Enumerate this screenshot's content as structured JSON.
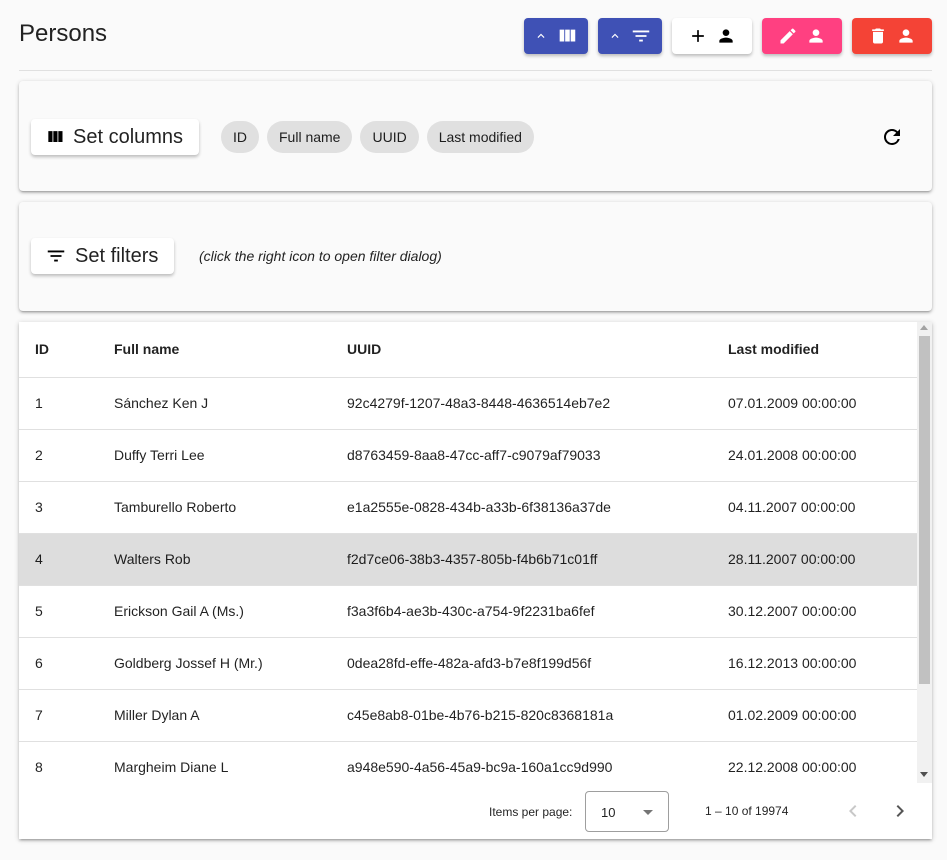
{
  "page": {
    "title": "Persons"
  },
  "toolbar": {
    "buttons": [
      {
        "name": "toggle-columns-button",
        "color": "#3f51b5",
        "icons": [
          "chevron-up-icon",
          "view-column-icon"
        ]
      },
      {
        "name": "toggle-filters-button",
        "color": "#3f51b5",
        "icons": [
          "chevron-up-icon",
          "filter-list-icon"
        ]
      },
      {
        "name": "add-person-button",
        "color": "#ffffff",
        "icons": [
          "plus-icon",
          "person-icon"
        ]
      },
      {
        "name": "edit-person-button",
        "color": "#ff4081",
        "icons": [
          "pencil-icon",
          "person-icon"
        ]
      },
      {
        "name": "delete-person-button",
        "color": "#f44336",
        "icons": [
          "trash-icon",
          "person-icon"
        ]
      }
    ]
  },
  "columns_panel": {
    "button_label": "Set columns",
    "chips": [
      "ID",
      "Full name",
      "UUID",
      "Last modified"
    ]
  },
  "filters_panel": {
    "button_label": "Set filters",
    "hint": "(click the right icon to open filter dialog)"
  },
  "table": {
    "headers": [
      "ID",
      "Full name",
      "UUID",
      "Last modified"
    ],
    "rows": [
      {
        "id": "1",
        "name": "Sánchez Ken J",
        "uuid": "92c4279f-1207-48a3-8448-4636514eb7e2",
        "modified": "07.01.2009 00:00:00"
      },
      {
        "id": "2",
        "name": "Duffy Terri Lee",
        "uuid": "d8763459-8aa8-47cc-aff7-c9079af79033",
        "modified": "24.01.2008 00:00:00"
      },
      {
        "id": "3",
        "name": "Tamburello Roberto",
        "uuid": "e1a2555e-0828-434b-a33b-6f38136a37de",
        "modified": "04.11.2007 00:00:00"
      },
      {
        "id": "4",
        "name": "Walters Rob",
        "uuid": "f2d7ce06-38b3-4357-805b-f4b6b71c01ff",
        "modified": "28.11.2007 00:00:00"
      },
      {
        "id": "5",
        "name": "Erickson Gail A (Ms.)",
        "uuid": "f3a3f6b4-ae3b-430c-a754-9f2231ba6fef",
        "modified": "30.12.2007 00:00:00"
      },
      {
        "id": "6",
        "name": "Goldberg Jossef H (Mr.)",
        "uuid": "0dea28fd-effe-482a-afd3-b7e8f199d56f",
        "modified": "16.12.2013 00:00:00"
      },
      {
        "id": "7",
        "name": "Miller Dylan A",
        "uuid": "c45e8ab8-01be-4b76-b215-820c8368181a",
        "modified": "01.02.2009 00:00:00"
      },
      {
        "id": "8",
        "name": "Margheim Diane L",
        "uuid": "a948e590-4a56-45a9-bc9a-160a1cc9d990",
        "modified": "22.12.2008 00:00:00"
      }
    ],
    "selected_row_index": 3
  },
  "paginator": {
    "items_per_page_label": "Items per page:",
    "page_size": "10",
    "range_label": "1 – 10 of 19974"
  }
}
